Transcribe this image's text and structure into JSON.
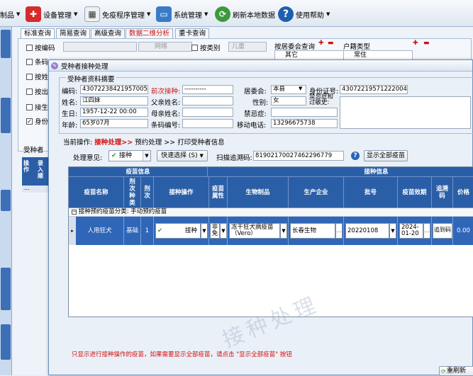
{
  "toolbar": {
    "items": [
      {
        "label": "制品",
        "icon": "vaccine-icon"
      },
      {
        "label": "设备管理",
        "icon": "device-icon"
      },
      {
        "label": "免疫程序管理",
        "icon": "schedule-icon"
      },
      {
        "label": "系统管理",
        "icon": "computer-icon"
      },
      {
        "label": "刷新本地数据",
        "icon": "refresh-icon"
      },
      {
        "label": "使用帮助",
        "icon": "help-icon"
      }
    ]
  },
  "bg": {
    "tabs": [
      "标准查询",
      "简易查询",
      "高级查询",
      "数据二维分析",
      "重卡查询"
    ],
    "checkboxes": [
      "按编码",
      "条码",
      "按姓",
      "按出",
      "接生",
      "身份"
    ],
    "combo_network": "网络",
    "by_category": "按类别",
    "category_value": "儿童",
    "committee_query": "按居委会查询",
    "committee_item": "其它",
    "household_type": "户籍类型",
    "household_item": "常住",
    "side_label": "受种者",
    "grid_col1": "操作",
    "grid_col2": "录入顺",
    "grid_dots": "..."
  },
  "modal": {
    "title": "受种者接种处理",
    "section": "受种者资料摘要",
    "fields": {
      "code_label": "编码:",
      "code": "430722384219570055",
      "prev_label": "前次接种:",
      "prev": "----------",
      "committee_label": "居委会:",
      "committee": "本县",
      "id_label": "身份证号:",
      "id": "430722195712220044",
      "name_label": "姓名:",
      "name": "江四妹",
      "father_label": "父亲姓名:",
      "father": "",
      "gender_label": "性别:",
      "gender": "女",
      "contra_label": "禁忌症和过敏史:",
      "birth_label": "生日:",
      "birth": "1957-12-22 00:00",
      "mother_label": "母亲姓名:",
      "mother": "",
      "forbid_label": "禁忌症:",
      "forbid": "",
      "age_label": "年龄:",
      "age": "65岁07月",
      "barcode_label": "条码编号:",
      "barcode": "",
      "mobile_label": "移动电话:",
      "mobile": "13296675738"
    },
    "steps": {
      "label": "当前操作:",
      "s1": "接种处理>>",
      "s2": "预约处理 >>",
      "s3": "打印受种者信息"
    },
    "opinion_label": "处理意见:",
    "opinion_value": "接种",
    "quick_select": "快速选择 (S)",
    "scan_label": "扫描追溯码:",
    "scan_value": "81902170027462296779",
    "show_all": "显示全部疫苗",
    "grid": {
      "group1": "疫苗信息",
      "group2": "接种信息",
      "headers": [
        "疫苗名称",
        "剂次种类",
        "剂次",
        "接种操作",
        "疫苗属性",
        "生物制品",
        "生产企业",
        "批号",
        "疫苗效期",
        "追溯码",
        "价格"
      ],
      "category_row": "接种预约疫苗分类: 手动预约疫苗",
      "row": {
        "name": "人用狂犬",
        "kind": "基础",
        "dose": "1",
        "op": "接种",
        "attr": "非免",
        "product": "冻干狂犬病疫苗（Vero）",
        "maker": "长春生物",
        "batch": "20220108",
        "expiry": "2024-01-20",
        "trace": "追到码",
        "price": "0.00"
      }
    },
    "watermark": "接种处理",
    "footer_note": "只显示进行接种操作的疫苗，如果需要显示全部疫苗，请点击 \"显示全部疫苗\" 按钮",
    "refresh_button": "重刷新"
  }
}
